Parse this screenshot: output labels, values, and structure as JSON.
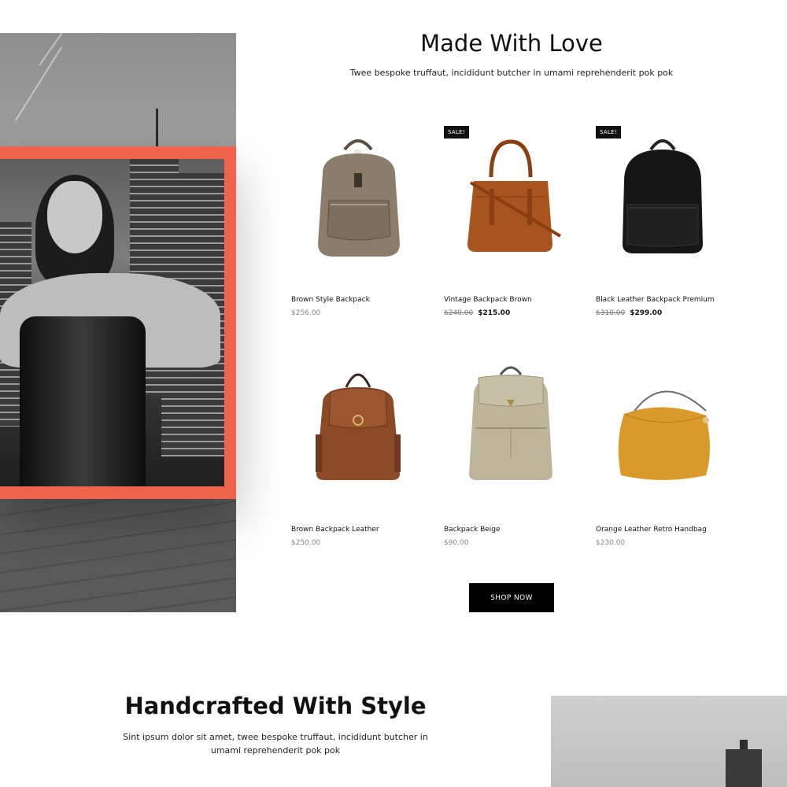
{
  "made_with_love": {
    "title": "Made With Love",
    "subtitle": "Twee bespoke truffaut, incididunt butcher in umami reprehenderit pok pok",
    "products": [
      {
        "name": "Brown Style Backpack",
        "price": "$256.00",
        "badge": "",
        "icon": "backpack-taupe",
        "color": "#8b7d6a"
      },
      {
        "name": "Vintage Backpack Brown",
        "price_old": "$240.00",
        "price_new": "$215.00",
        "badge": "SALE!",
        "icon": "handbag-cognac",
        "color": "#a7541e"
      },
      {
        "name": "Black Leather Backpack Premium",
        "price_old": "$310.00",
        "price_new": "$299.00",
        "badge": "SALE!",
        "icon": "backpack-black",
        "color": "#161616"
      },
      {
        "name": "Brown Backpack Leather",
        "price": "$250.00",
        "badge": "",
        "icon": "backpack-brown",
        "color": "#8a4a26"
      },
      {
        "name": "Backpack Beige",
        "price": "$90.00",
        "badge": "",
        "icon": "backpack-beige",
        "color": "#bdb49a"
      },
      {
        "name": "Orange Leather Retro Handbag",
        "price": "$230.00",
        "badge": "",
        "icon": "handbag-mustard",
        "color": "#d99a2b"
      }
    ],
    "cta": "SHOP NOW"
  },
  "handcrafted": {
    "title": "Handcrafted With Style",
    "subtitle_line1": "Sint ipsum dolor sit amet, twee bespoke truffaut, incididunt butcher in",
    "subtitle_line2": "umami reprehenderit pok pok"
  },
  "colors": {
    "accent_frame": "#f0644e",
    "button_bg": "#000000",
    "text": "#111111"
  }
}
